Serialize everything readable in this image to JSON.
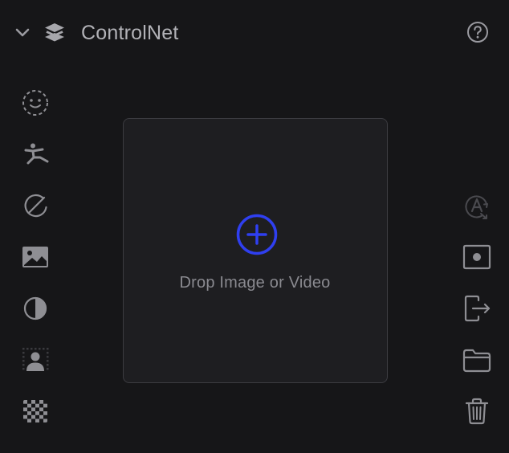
{
  "panel": {
    "title": "ControlNet",
    "collapse_icon": "chevron-down-icon",
    "title_icon": "layers-icon",
    "help_icon": "help-circle-icon"
  },
  "left_tools": [
    {
      "name": "face-detect-icon"
    },
    {
      "name": "pose-icon"
    },
    {
      "name": "edge-detect-icon"
    },
    {
      "name": "image-icon"
    },
    {
      "name": "contrast-icon"
    },
    {
      "name": "person-segmentation-icon"
    },
    {
      "name": "checkerboard-icon"
    }
  ],
  "right_tools": [
    {
      "name": "auto-text-icon",
      "disabled": true
    },
    {
      "name": "capture-frame-icon"
    },
    {
      "name": "export-icon"
    },
    {
      "name": "folder-icon"
    },
    {
      "name": "trash-icon"
    }
  ],
  "dropzone": {
    "label": "Drop Image or Video",
    "icon": "plus-circle-icon"
  },
  "colors": {
    "background": "#161618",
    "dropzone_bg": "#1e1e21",
    "dropzone_border": "#3c3c41",
    "icon": "#8e8e93",
    "icon_disabled": "#4a4a4f",
    "accent": "#2f3ff0"
  }
}
